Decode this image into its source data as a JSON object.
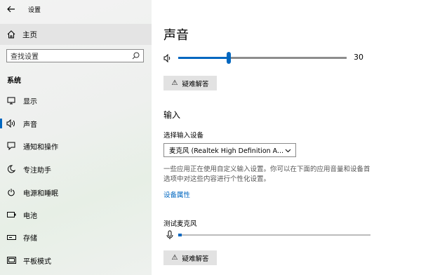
{
  "app": {
    "title": "设置"
  },
  "sidebar": {
    "home_label": "主页",
    "search_placeholder": "查找设置",
    "section_title": "系统",
    "items": [
      {
        "label": "显示",
        "icon": "monitor-icon"
      },
      {
        "label": "声音",
        "icon": "speaker-icon",
        "selected": true
      },
      {
        "label": "通知和操作",
        "icon": "notification-icon"
      },
      {
        "label": "专注助手",
        "icon": "moon-icon"
      },
      {
        "label": "电源和睡眠",
        "icon": "power-icon"
      },
      {
        "label": "电池",
        "icon": "battery-icon"
      },
      {
        "label": "存储",
        "icon": "storage-icon"
      },
      {
        "label": "平板模式",
        "icon": "tablet-icon"
      }
    ]
  },
  "main": {
    "title": "声音",
    "volume": {
      "value": 30,
      "label": "30"
    },
    "troubleshoot_label": "疑难解答",
    "input": {
      "heading": "输入",
      "select_label": "选择输入设备",
      "selected_device": "麦克风 (Realtek High Definition A...",
      "description": "一些应用正在使用自定义输入设置。你可以在下面的应用音量和设备首选项中对这些内容进行个性化设置。",
      "device_properties_link": "设备属性",
      "test_mic_label": "测试麦克风",
      "mic_level": 0.02,
      "troubleshoot_label": "疑难解答"
    }
  },
  "colors": {
    "accent": "#0067c0",
    "sidebar_bg": "#f0f2f0",
    "button_bg": "#e2e2e2"
  }
}
